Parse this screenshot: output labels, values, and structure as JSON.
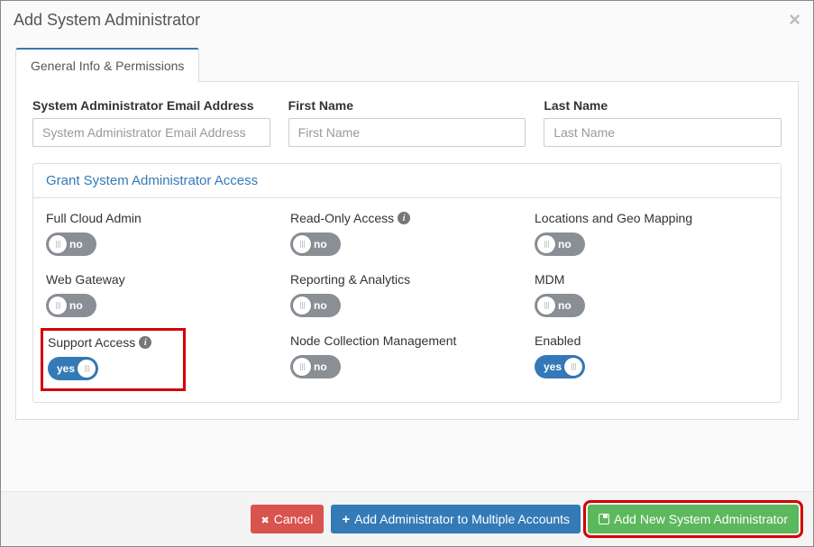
{
  "modal": {
    "title": "Add System Administrator"
  },
  "tabs": {
    "general": "General Info & Permissions"
  },
  "fields": {
    "email": {
      "label": "System Administrator Email Address",
      "placeholder": "System Administrator Email Address"
    },
    "first_name": {
      "label": "First Name",
      "placeholder": "First Name"
    },
    "last_name": {
      "label": "Last Name",
      "placeholder": "Last Name"
    }
  },
  "grant": {
    "header": "Grant System Administrator Access",
    "yes": "yes",
    "no": "no",
    "perms": {
      "full_cloud_admin": {
        "label": "Full Cloud Admin",
        "state": "no"
      },
      "read_only": {
        "label": "Read-Only Access",
        "state": "no",
        "info": true
      },
      "locations": {
        "label": "Locations and Geo Mapping",
        "state": "no"
      },
      "web_gateway": {
        "label": "Web Gateway",
        "state": "no"
      },
      "reporting": {
        "label": "Reporting & Analytics",
        "state": "no"
      },
      "mdm": {
        "label": "MDM",
        "state": "no"
      },
      "support_access": {
        "label": "Support Access",
        "state": "yes",
        "info": true,
        "highlight": true
      },
      "node_collection": {
        "label": "Node Collection Management",
        "state": "no"
      },
      "enabled": {
        "label": "Enabled",
        "state": "yes"
      }
    }
  },
  "footer": {
    "cancel": "Cancel",
    "multi": "Add Administrator to Multiple Accounts",
    "add": "Add New System Administrator"
  }
}
